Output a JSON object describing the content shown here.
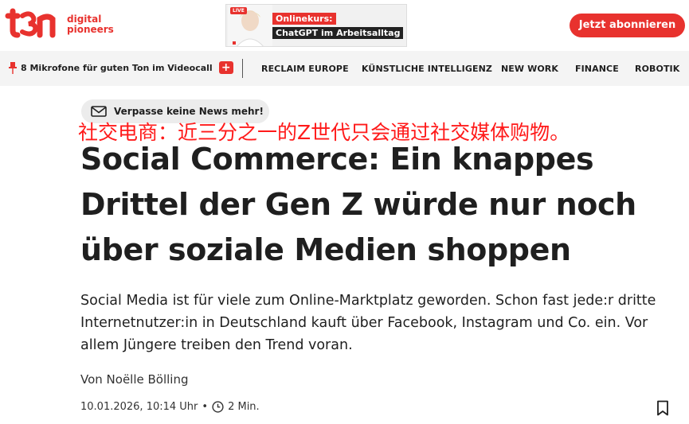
{
  "header": {
    "logo_text_line1": "digital",
    "logo_text_line2": "pioneers",
    "ad": {
      "live_badge": "LIVE",
      "line1": "Onlinekurs:",
      "line2": "ChatGPT im Arbeitsalltag"
    },
    "subscribe_label": "Jetzt abonnieren"
  },
  "nav": {
    "promo_label": "8 Mikrofone für guten Ton im Videocall",
    "items": [
      "RECLAIM EUROPE",
      "KÜNSTLICHE INTELLIGENZ",
      "NEW WORK",
      "FINANCE",
      "ROBOTIK"
    ]
  },
  "article": {
    "newsletter_label": "Verpasse keine News mehr!",
    "overlay_translation": "社交电商：近三分之一的Z世代只会通过社交媒体购物。",
    "headline": "Social Commerce: Ein knappes Drittel der Gen Z würde nur noch über soziale Medien shoppen",
    "lead": "Social Media ist für viele zum Online-Marktplatz geworden. Schon fast jede:r dritte Internetnutzer:in in Deutschland kauft über Facebook, Instagram und Co. ein. Vor allem Jüngere treiben den Trend voran.",
    "author": "Von Noëlle Bölling",
    "date": "10.01.2026, 10:14 Uhr",
    "separator": "•",
    "read_time": "2 Min."
  },
  "colors": {
    "brand": "#e8322e",
    "nav_bg": "#f4f4f4",
    "text": "#1f1f1f"
  }
}
